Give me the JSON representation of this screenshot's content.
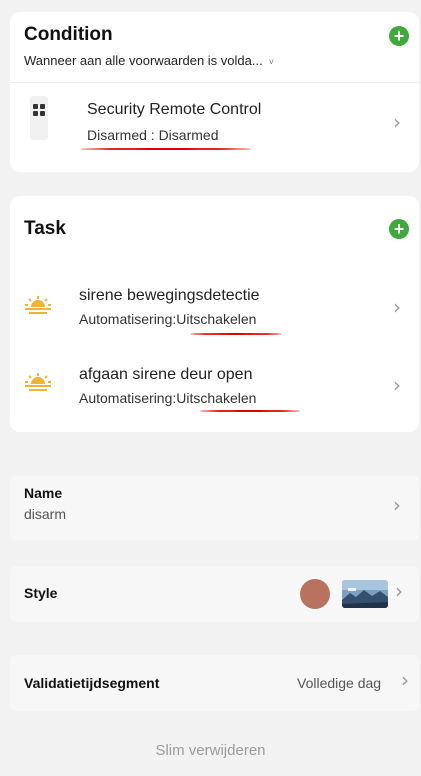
{
  "condition": {
    "title": "Condition",
    "subtitle": "Wanneer aan alle voorwaarden is volda...",
    "subtitle_caret": "˅",
    "items": [
      {
        "title": "Security Remote Control",
        "status": "Disarmed : Disarmed",
        "icon": "remote-control-icon"
      }
    ]
  },
  "task": {
    "title": "Task",
    "items": [
      {
        "title": "sirene bewegingsdetectie",
        "status": "Automatisering:Uitschakelen",
        "icon": "sunrise-icon"
      },
      {
        "title": "afgaan sirene deur open",
        "status": "Automatisering:Uitschakelen",
        "icon": "sunrise-icon"
      }
    ]
  },
  "name": {
    "label": "Name",
    "value": "disarm"
  },
  "style": {
    "label": "Style",
    "color": "#b8725f"
  },
  "validity": {
    "label": "Validatietijdsegment",
    "value": "Volledige dag"
  },
  "delete_label": "Slim verwijderen",
  "colors": {
    "accent_green": "#3daa3a",
    "annotation_red": "#e00000",
    "sun_yellow": "#f2b233"
  },
  "glyphs": {
    "add": "+",
    "chevron": "›"
  }
}
